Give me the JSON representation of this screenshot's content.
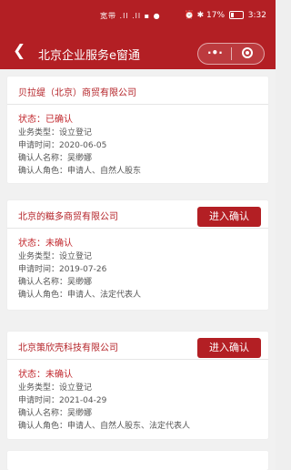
{
  "status_bar": {
    "left_text": "宽带 .ll .ll ▪ ●",
    "right_text": "⏰ ✱ 17%",
    "time": "3:32"
  },
  "nav": {
    "back_icon": "❮",
    "title": "北京企业服务e窗通",
    "more_icon": "·•·"
  },
  "cards": [
    {
      "company": "贝拉缇（北京）商贸有限公司",
      "status": "状态：已确认",
      "business": "业务类型：设立登记",
      "apply_time": "申请时间：2020-06-05",
      "person": "确认人名称：吴缈娜",
      "role": "确认人角色：申请人、自然人股东"
    },
    {
      "company": "北京的糍多商贸有限公司",
      "button": "进入确认",
      "status": "状态：未确认",
      "business": "业务类型：设立登记",
      "apply_time": "申请时间：2019-07-26",
      "person": "确认人名称：吴缈娜",
      "role": "确认人角色：申请人、法定代表人"
    },
    {
      "company": "北京策欣壳科技有限公司",
      "button": "进入确认",
      "status": "状态：未确认",
      "business": "业务类型：设立登记",
      "apply_time": "申请时间：2021-04-29",
      "person": "确认人名称：吴缈娜",
      "role": "确认人角色：申请人、自然人股东、法定代表人"
    }
  ],
  "colors": {
    "brand_red": "#b31f24",
    "status_red": "#c1272d",
    "background": "#f1f1f1"
  }
}
